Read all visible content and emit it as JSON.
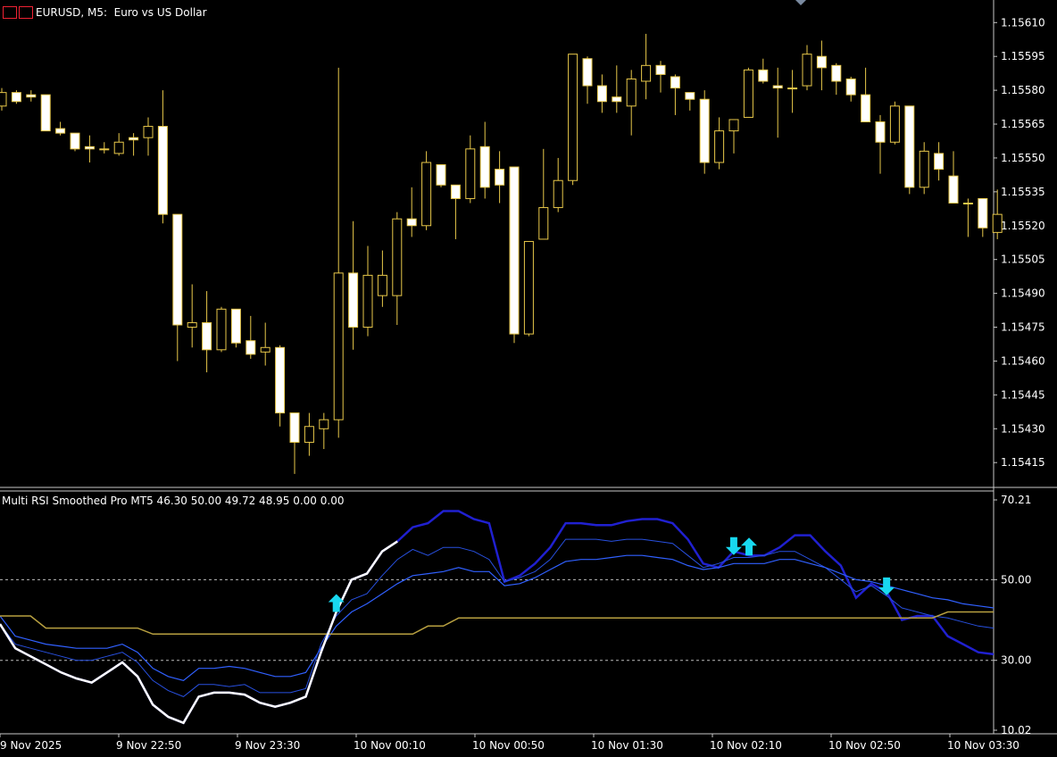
{
  "header": {
    "symbol": "EURUSD, M5:",
    "description": "Euro vs US Dollar",
    "icons": [
      "menu-icon",
      "chart-type-icon"
    ]
  },
  "indicator": {
    "label": "Multi RSI Smoothed Pro MT5 46.30 50.00 49.72 48.95 0.00 0.00"
  },
  "colors": {
    "background": "#000000",
    "candle_up": "#000000",
    "candle_down": "#ffffff",
    "candle_outline": "#e8c84a",
    "axis": "#c8c8c8",
    "text": "#ffffff",
    "rsi_main": "#ffffff",
    "rsi_main_dark": "#2020d0",
    "rsi_mid": "#2850e0",
    "rsi_slow": "#3060ff",
    "rsi_gold": "#b8a040",
    "arrow": "#18d8f0"
  },
  "chart_data": [
    {
      "type": "candlestick",
      "symbol": "EURUSD",
      "timeframe": "M5",
      "price_ticks": [
        "1.15610",
        "1.15595",
        "1.15580",
        "1.15565",
        "1.15550",
        "1.15535",
        "1.15520",
        "1.15505",
        "1.15490",
        "1.15475",
        "1.15460",
        "1.15445",
        "1.15430",
        "1.15415"
      ],
      "ylim": [
        1.15404,
        1.1562
      ],
      "time_labels": [
        "9 Nov 2025",
        "9 Nov 22:50",
        "9 Nov 23:30",
        "10 Nov 00:10",
        "10 Nov 00:50",
        "10 Nov 01:30",
        "10 Nov 02:10",
        "10 Nov 02:50",
        "10 Nov 03:30"
      ],
      "candles": [
        {
          "o": 1.15573,
          "h": 1.15581,
          "l": 1.15571,
          "c": 1.15579
        },
        {
          "o": 1.15579,
          "h": 1.1558,
          "l": 1.15574,
          "c": 1.15575
        },
        {
          "o": 1.15578,
          "h": 1.1558,
          "l": 1.15575,
          "c": 1.15577
        },
        {
          "o": 1.15578,
          "h": 1.15578,
          "l": 1.15562,
          "c": 1.15562
        },
        {
          "o": 1.15563,
          "h": 1.15566,
          "l": 1.1556,
          "c": 1.15561
        },
        {
          "o": 1.15561,
          "h": 1.15561,
          "l": 1.15553,
          "c": 1.15554
        },
        {
          "o": 1.15555,
          "h": 1.1556,
          "l": 1.15548,
          "c": 1.15554
        },
        {
          "o": 1.15554,
          "h": 1.15557,
          "l": 1.15552,
          "c": 1.15554
        },
        {
          "o": 1.15552,
          "h": 1.15561,
          "l": 1.15551,
          "c": 1.15557
        },
        {
          "o": 1.15559,
          "h": 1.15561,
          "l": 1.15551,
          "c": 1.15558
        },
        {
          "o": 1.15559,
          "h": 1.15568,
          "l": 1.15551,
          "c": 1.15564
        },
        {
          "o": 1.15564,
          "h": 1.1558,
          "l": 1.15521,
          "c": 1.15525
        },
        {
          "o": 1.15525,
          "h": 1.15525,
          "l": 1.1546,
          "c": 1.15476
        },
        {
          "o": 1.15475,
          "h": 1.15494,
          "l": 1.15466,
          "c": 1.15477
        },
        {
          "o": 1.15477,
          "h": 1.15491,
          "l": 1.15455,
          "c": 1.15465
        },
        {
          "o": 1.15465,
          "h": 1.15484,
          "l": 1.15464,
          "c": 1.15483
        },
        {
          "o": 1.15483,
          "h": 1.15483,
          "l": 1.15466,
          "c": 1.15468
        },
        {
          "o": 1.15469,
          "h": 1.1548,
          "l": 1.15461,
          "c": 1.15463
        },
        {
          "o": 1.15464,
          "h": 1.15477,
          "l": 1.15458,
          "c": 1.15466
        },
        {
          "o": 1.15466,
          "h": 1.15467,
          "l": 1.15431,
          "c": 1.15437
        },
        {
          "o": 1.15437,
          "h": 1.15437,
          "l": 1.1541,
          "c": 1.15424
        },
        {
          "o": 1.15424,
          "h": 1.15437,
          "l": 1.15418,
          "c": 1.15431
        },
        {
          "o": 1.1543,
          "h": 1.15437,
          "l": 1.15421,
          "c": 1.15434
        },
        {
          "o": 1.15434,
          "h": 1.1559,
          "l": 1.15426,
          "c": 1.15499
        },
        {
          "o": 1.15499,
          "h": 1.15522,
          "l": 1.15465,
          "c": 1.15475
        },
        {
          "o": 1.15475,
          "h": 1.15511,
          "l": 1.15471,
          "c": 1.15498
        },
        {
          "o": 1.15489,
          "h": 1.15509,
          "l": 1.15484,
          "c": 1.15498
        },
        {
          "o": 1.15489,
          "h": 1.15526,
          "l": 1.15476,
          "c": 1.15523
        },
        {
          "o": 1.15523,
          "h": 1.15537,
          "l": 1.15515,
          "c": 1.1552
        },
        {
          "o": 1.1552,
          "h": 1.15553,
          "l": 1.15518,
          "c": 1.15548
        },
        {
          "o": 1.15547,
          "h": 1.15547,
          "l": 1.15537,
          "c": 1.15538
        },
        {
          "o": 1.15538,
          "h": 1.15538,
          "l": 1.15514,
          "c": 1.15532
        },
        {
          "o": 1.15532,
          "h": 1.1556,
          "l": 1.1553,
          "c": 1.15554
        },
        {
          "o": 1.15555,
          "h": 1.15566,
          "l": 1.15532,
          "c": 1.15537
        },
        {
          "o": 1.15545,
          "h": 1.15553,
          "l": 1.1553,
          "c": 1.15538
        },
        {
          "o": 1.15546,
          "h": 1.15546,
          "l": 1.15468,
          "c": 1.15472
        },
        {
          "o": 1.15472,
          "h": 1.15513,
          "l": 1.15471,
          "c": 1.15513
        },
        {
          "o": 1.15514,
          "h": 1.15554,
          "l": 1.15514,
          "c": 1.15528
        },
        {
          "o": 1.15528,
          "h": 1.1555,
          "l": 1.15526,
          "c": 1.1554
        },
        {
          "o": 1.1554,
          "h": 1.15596,
          "l": 1.15538,
          "c": 1.15596
        },
        {
          "o": 1.15594,
          "h": 1.15595,
          "l": 1.15574,
          "c": 1.15582
        },
        {
          "o": 1.15582,
          "h": 1.15587,
          "l": 1.1557,
          "c": 1.15575
        },
        {
          "o": 1.15577,
          "h": 1.15591,
          "l": 1.1557,
          "c": 1.15575
        },
        {
          "o": 1.15573,
          "h": 1.15589,
          "l": 1.1556,
          "c": 1.15585
        },
        {
          "o": 1.15584,
          "h": 1.15605,
          "l": 1.15576,
          "c": 1.15591
        },
        {
          "o": 1.15591,
          "h": 1.15593,
          "l": 1.15579,
          "c": 1.15587
        },
        {
          "o": 1.15586,
          "h": 1.15587,
          "l": 1.15569,
          "c": 1.15581
        },
        {
          "o": 1.15579,
          "h": 1.15579,
          "l": 1.15571,
          "c": 1.15576
        },
        {
          "o": 1.15576,
          "h": 1.1558,
          "l": 1.15543,
          "c": 1.15548
        },
        {
          "o": 1.15548,
          "h": 1.15568,
          "l": 1.15545,
          "c": 1.15562
        },
        {
          "o": 1.15562,
          "h": 1.15567,
          "l": 1.15552,
          "c": 1.15567
        },
        {
          "o": 1.15568,
          "h": 1.1559,
          "l": 1.15568,
          "c": 1.15589
        },
        {
          "o": 1.15589,
          "h": 1.15594,
          "l": 1.15583,
          "c": 1.15584
        },
        {
          "o": 1.15582,
          "h": 1.1559,
          "l": 1.15559,
          "c": 1.15581
        },
        {
          "o": 1.15581,
          "h": 1.15589,
          "l": 1.1557,
          "c": 1.15581
        },
        {
          "o": 1.15582,
          "h": 1.156,
          "l": 1.1558,
          "c": 1.15596
        },
        {
          "o": 1.15595,
          "h": 1.15602,
          "l": 1.1558,
          "c": 1.1559
        },
        {
          "o": 1.15591,
          "h": 1.15592,
          "l": 1.15578,
          "c": 1.15584
        },
        {
          "o": 1.15585,
          "h": 1.15586,
          "l": 1.15575,
          "c": 1.15578
        },
        {
          "o": 1.15578,
          "h": 1.1559,
          "l": 1.15572,
          "c": 1.15566
        },
        {
          "o": 1.15566,
          "h": 1.15569,
          "l": 1.15543,
          "c": 1.15557
        },
        {
          "o": 1.15557,
          "h": 1.15575,
          "l": 1.15556,
          "c": 1.15573
        },
        {
          "o": 1.15573,
          "h": 1.15573,
          "l": 1.15534,
          "c": 1.15537
        },
        {
          "o": 1.15537,
          "h": 1.15557,
          "l": 1.15534,
          "c": 1.15553
        },
        {
          "o": 1.15552,
          "h": 1.15557,
          "l": 1.1554,
          "c": 1.15545
        },
        {
          "o": 1.15542,
          "h": 1.15553,
          "l": 1.15532,
          "c": 1.1553
        },
        {
          "o": 1.1553,
          "h": 1.15532,
          "l": 1.15515,
          "c": 1.1553
        },
        {
          "o": 1.15532,
          "h": 1.15532,
          "l": 1.15515,
          "c": 1.15519
        },
        {
          "o": 1.15517,
          "h": 1.15536,
          "l": 1.15514,
          "c": 1.15525
        }
      ]
    },
    {
      "type": "line",
      "title": "Multi RSI Smoothed Pro MT5",
      "ylim": [
        10.02,
        70.21
      ],
      "y_ticks": [
        "70.21",
        "50.00",
        "30.00",
        "10.02"
      ],
      "levels": [
        50,
        30
      ],
      "series": [
        {
          "name": "RSI fast",
          "values": [
            39,
            33,
            31,
            29,
            27,
            25.5,
            24.5,
            27,
            29.5,
            26,
            19,
            16,
            14.5,
            21,
            22,
            22,
            21.5,
            19.5,
            18.5,
            19.5,
            21,
            32,
            42,
            50,
            51.5,
            57,
            59.5,
            63,
            64,
            67,
            67,
            65,
            64,
            49.5,
            51,
            54,
            58,
            64,
            64,
            63.5,
            63.5,
            64.5,
            65,
            65,
            64,
            60,
            54,
            53,
            57,
            56,
            56,
            58,
            61,
            61,
            57,
            53.5,
            45.5,
            49,
            47,
            40,
            41,
            41,
            36,
            34,
            32,
            31.5
          ]
        },
        {
          "name": "RSI mid",
          "values": [
            39,
            34,
            33,
            32,
            31,
            30,
            30,
            31,
            32,
            29.5,
            25,
            22.5,
            21,
            24,
            24,
            23.5,
            24,
            22,
            22,
            22,
            23,
            34,
            41,
            45,
            46.5,
            51,
            55,
            57.5,
            56,
            58,
            58,
            57,
            55,
            49.5,
            50.5,
            52,
            55,
            60,
            60,
            60,
            59.5,
            60,
            60,
            59.5,
            59,
            56,
            53,
            54,
            55.5,
            55.5,
            56,
            57,
            57,
            55,
            53,
            50,
            47,
            48.5,
            46,
            43,
            42,
            41,
            40.5,
            39.5,
            38.5,
            38
          ]
        },
        {
          "name": "RSI slow",
          "values": [
            41,
            36,
            35,
            34,
            33.5,
            33,
            33,
            33,
            34,
            32,
            28,
            26,
            25,
            28,
            28,
            28.5,
            28,
            27,
            26,
            26,
            27,
            33,
            38.5,
            42,
            44,
            46.5,
            49,
            51,
            51.5,
            52,
            53,
            52,
            52,
            48.5,
            49,
            50.5,
            52.5,
            54.5,
            55,
            55,
            55.5,
            56,
            56,
            55.5,
            55,
            53.5,
            52.5,
            53,
            54,
            54,
            54,
            55,
            55,
            54,
            53,
            51.5,
            50,
            49.5,
            48.5,
            47.5,
            46.5,
            45.5,
            45,
            44,
            43.5,
            43
          ]
        },
        {
          "name": "Signal",
          "values": [
            41,
            41,
            41,
            38,
            38,
            38,
            38,
            38,
            38,
            38,
            36.5,
            36.5,
            36.5,
            36.5,
            36.5,
            36.5,
            36.5,
            36.5,
            36.5,
            36.5,
            36.5,
            36.5,
            36.5,
            36.5,
            36.5,
            36.5,
            36.5,
            36.5,
            38.5,
            38.5,
            40.5,
            40.5,
            40.5,
            40.5,
            40.5,
            40.5,
            40.5,
            40.5,
            40.5,
            40.5,
            40.5,
            40.5,
            40.5,
            40.5,
            40.5,
            40.5,
            40.5,
            40.5,
            40.5,
            40.5,
            40.5,
            40.5,
            40.5,
            40.5,
            40.5,
            40.5,
            40.5,
            40.5,
            40.5,
            40.5,
            40.5,
            40.5,
            42,
            42,
            42,
            42
          ]
        }
      ],
      "signals": [
        {
          "index": 22,
          "dir": "up"
        },
        {
          "index": 48,
          "dir": "down"
        },
        {
          "index": 49,
          "dir": "up"
        },
        {
          "index": 58,
          "dir": "down"
        }
      ]
    }
  ]
}
